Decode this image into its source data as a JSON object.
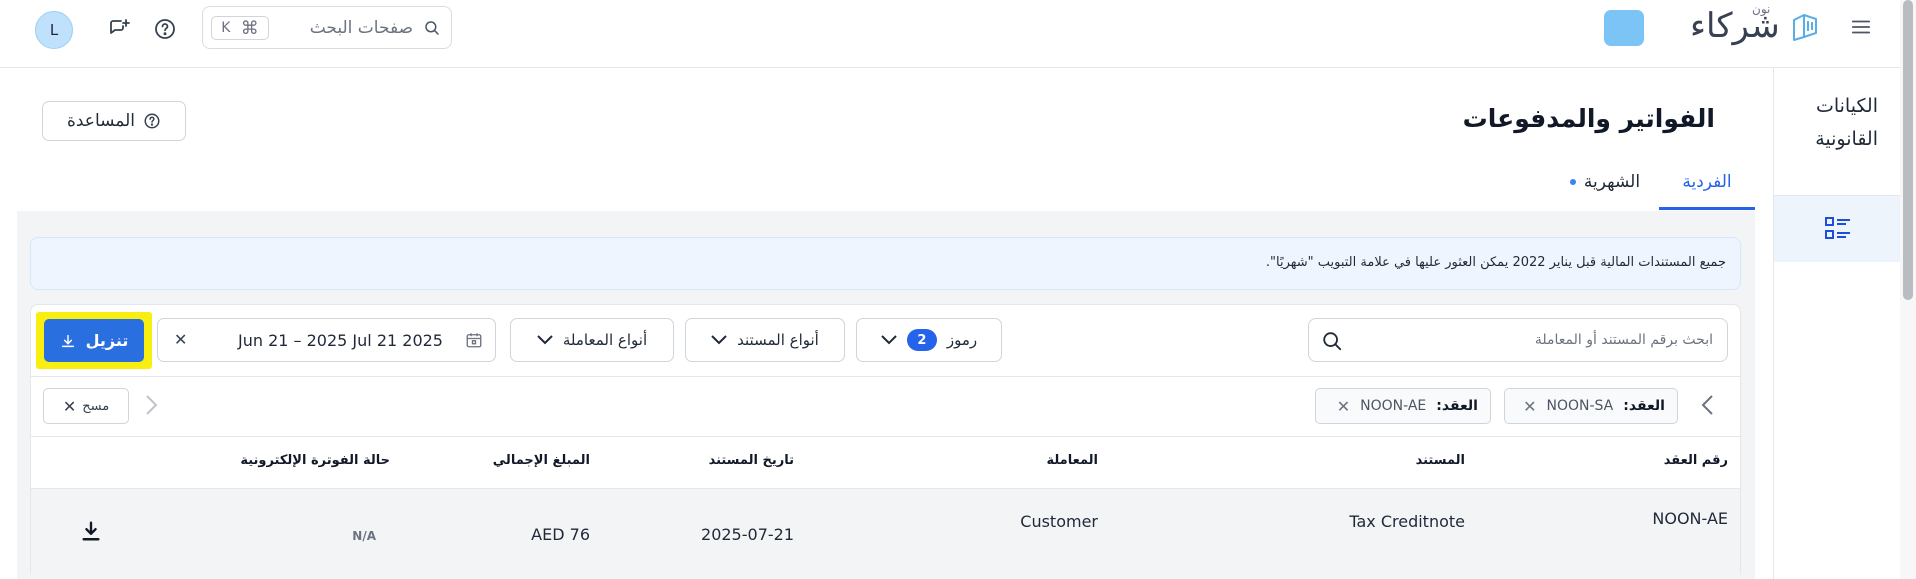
{
  "topbar": {
    "avatar_initial": "L",
    "search": {
      "placeholder": "صفحات البحث",
      "shortcut_cmd": "⌘",
      "shortcut_key": "K"
    },
    "brand": {
      "name": "شركاء",
      "sub": "نون"
    },
    "brand_color": "#7dc4f6"
  },
  "sidebar": {
    "section_label": "الكيانات القانونية",
    "items": [
      {
        "icon": "list-details-icon",
        "active": true
      }
    ]
  },
  "header": {
    "title": "الفواتير والمدفوعات",
    "help_label": "المساعدة"
  },
  "tabs": [
    {
      "label": "الفردية",
      "active": true
    },
    {
      "label": "الشهرية",
      "active": false,
      "has_dot": true
    }
  ],
  "notice": "جميع المستندات المالية قبل يناير 2022 يمكن العثور عليها في علامة التبويب \"شهريًا\".",
  "filters": {
    "search_placeholder": "ابحث برقم المستند أو المعاملة",
    "codes_label": "رموز",
    "codes_count": "2",
    "doc_types_label": "أنواع المستند",
    "txn_types_label": "أنواع المعاملة",
    "date_range": "Jun 21 – 2025 Jul 21 2025",
    "download_label": "تنزيل"
  },
  "chips": [
    {
      "key": "العقد:",
      "value": "NOON-SA"
    },
    {
      "key": "العقد:",
      "value": "NOON-AE"
    }
  ],
  "clear_label": "مسح",
  "table": {
    "columns": [
      "رقم العقد",
      "المستند",
      "المعاملة",
      "تاريخ المستند",
      "المبلغ الإجمالي",
      "حالة الفوترة الإلكترونية"
    ],
    "rows": [
      {
        "contract": "NOON-AE",
        "document": "Tax Creditnote",
        "transaction": "Customer",
        "date": "2025-07-21",
        "amount": "AED 76",
        "einvoice_status": "N/A"
      }
    ]
  },
  "colors": {
    "accent": "#2563eb",
    "download_highlight": "#f8ef10",
    "panel_bg": "#f3f4f6"
  }
}
